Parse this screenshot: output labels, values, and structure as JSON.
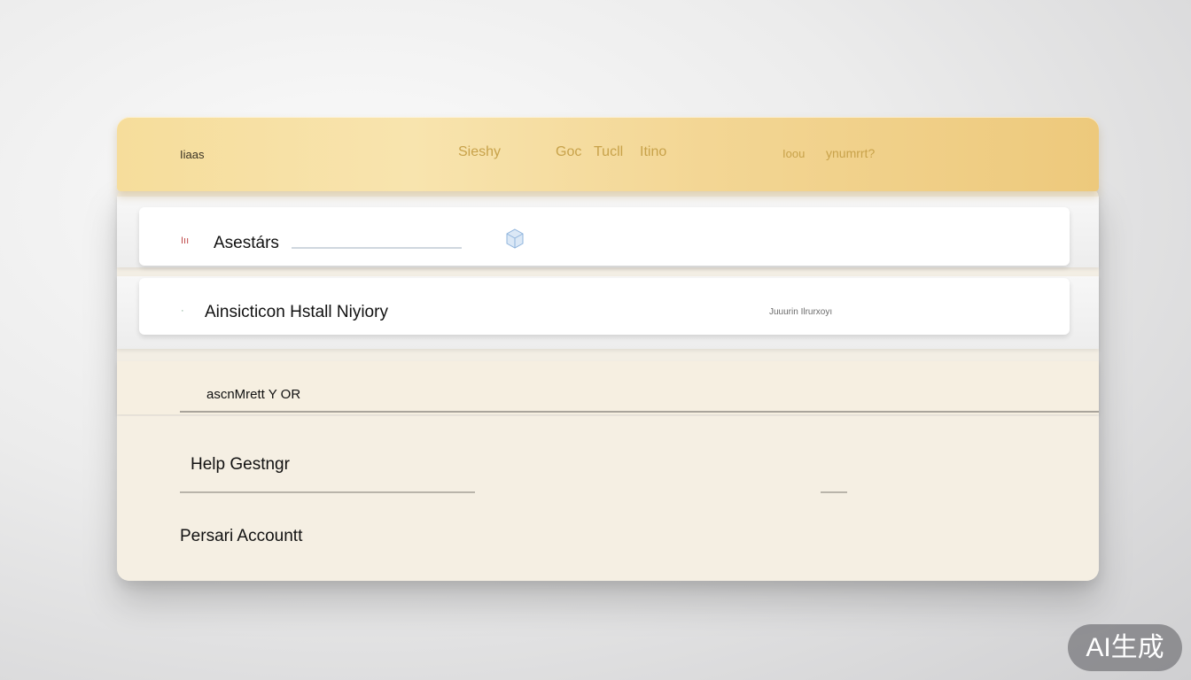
{
  "header": {
    "home_label": "Iiaas",
    "nav_items": [
      {
        "label": "Sieshy"
      },
      {
        "label": "Goc"
      },
      {
        "label": "Tucll"
      },
      {
        "label": "Itino"
      },
      {
        "label": "Ioou"
      },
      {
        "label": "ynumrrt?"
      }
    ]
  },
  "rows": [
    {
      "label": "Asestárs",
      "prefix": "Iıı"
    },
    {
      "label": "Ainsicticon Hstall Niyiory",
      "prefix": "·",
      "side_text": "Juuurin Ilrurxoyı"
    }
  ],
  "cream_section": {
    "heading": "ascnMrett Y OR",
    "items": [
      {
        "label": "Help Gestngr"
      },
      {
        "label": "Persari Accountt"
      }
    ]
  },
  "watermark": "AI生成",
  "colors": {
    "header_gold": "#f6dd9b",
    "header_text": "#c8a24a",
    "cream": "#f5efe3",
    "accent_green": "#3f9a5a"
  }
}
